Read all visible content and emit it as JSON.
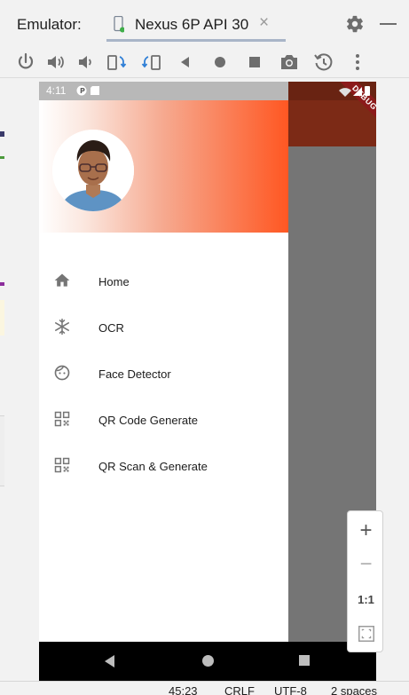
{
  "window": {
    "title": "Emulator:",
    "tab_label": "Nexus 6P API 30",
    "tab_close": "×"
  },
  "toolbar": {
    "buttons": [
      "power-icon",
      "volume-up-icon",
      "volume-down-icon",
      "rotate-left-icon",
      "rotate-right-icon",
      "back-icon",
      "home-icon",
      "overview-icon",
      "camera-icon",
      "snapshot-icon",
      "more-icon"
    ]
  },
  "device": {
    "status_time": "4:11",
    "debug_banner": "DEBUG",
    "menu": [
      {
        "label": "Home",
        "icon": "home-icon"
      },
      {
        "label": "OCR",
        "icon": "snowflake-icon"
      },
      {
        "label": "Face Detector",
        "icon": "face-icon"
      },
      {
        "label": "QR Code Generate",
        "icon": "qr-code-icon"
      },
      {
        "label": "QR Scan & Generate",
        "icon": "qr-code-icon"
      }
    ]
  },
  "zoom": {
    "plus": "+",
    "minus": "−",
    "one_to_one": "1:1"
  },
  "status_bar": {
    "position": "45:23",
    "line_sep": "CRLF",
    "encoding": "UTF-8",
    "indent": "2 spaces"
  },
  "colors": {
    "drawer_gradient_end": "#ff5722",
    "app_bar": "#7c2a16",
    "tab_underline": "#a9b5c8"
  }
}
